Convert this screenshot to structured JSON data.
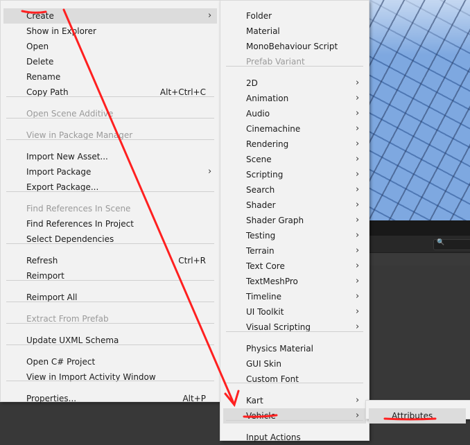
{
  "context_menu": {
    "items": [
      {
        "label": "Create",
        "shortcut": "",
        "submenu": true,
        "disabled": false
      },
      {
        "label": "Show in Explorer",
        "shortcut": "",
        "submenu": false,
        "disabled": false
      },
      {
        "label": "Open",
        "shortcut": "",
        "submenu": false,
        "disabled": false
      },
      {
        "label": "Delete",
        "shortcut": "",
        "submenu": false,
        "disabled": false
      },
      {
        "label": "Rename",
        "shortcut": "",
        "submenu": false,
        "disabled": false
      },
      {
        "label": "Copy Path",
        "shortcut": "Alt+Ctrl+C",
        "submenu": false,
        "disabled": false
      },
      {
        "label": "Open Scene Additive",
        "shortcut": "",
        "submenu": false,
        "disabled": true
      },
      {
        "label": "View in Package Manager",
        "shortcut": "",
        "submenu": false,
        "disabled": true
      },
      {
        "label": "Import New Asset...",
        "shortcut": "",
        "submenu": false,
        "disabled": false
      },
      {
        "label": "Import Package",
        "shortcut": "",
        "submenu": true,
        "disabled": false
      },
      {
        "label": "Export Package...",
        "shortcut": "",
        "submenu": false,
        "disabled": false
      },
      {
        "label": "Find References In Scene",
        "shortcut": "",
        "submenu": false,
        "disabled": true
      },
      {
        "label": "Find References In Project",
        "shortcut": "",
        "submenu": false,
        "disabled": false
      },
      {
        "label": "Select Dependencies",
        "shortcut": "",
        "submenu": false,
        "disabled": false
      },
      {
        "label": "Refresh",
        "shortcut": "Ctrl+R",
        "submenu": false,
        "disabled": false
      },
      {
        "label": "Reimport",
        "shortcut": "",
        "submenu": false,
        "disabled": false
      },
      {
        "label": "Reimport All",
        "shortcut": "",
        "submenu": false,
        "disabled": false
      },
      {
        "label": "Extract From Prefab",
        "shortcut": "",
        "submenu": false,
        "disabled": true
      },
      {
        "label": "Update UXML Schema",
        "shortcut": "",
        "submenu": false,
        "disabled": false
      },
      {
        "label": "Open C# Project",
        "shortcut": "",
        "submenu": false,
        "disabled": false
      },
      {
        "label": "View in Import Activity Window",
        "shortcut": "",
        "submenu": false,
        "disabled": false
      },
      {
        "label": "Properties...",
        "shortcut": "Alt+P",
        "submenu": false,
        "disabled": false
      }
    ]
  },
  "create_submenu": {
    "items": [
      {
        "label": "Folder",
        "submenu": false,
        "disabled": false
      },
      {
        "label": "Material",
        "submenu": false,
        "disabled": false
      },
      {
        "label": "MonoBehaviour Script",
        "submenu": false,
        "disabled": false
      },
      {
        "label": "Prefab Variant",
        "submenu": false,
        "disabled": true
      },
      {
        "label": "2D",
        "submenu": true,
        "disabled": false
      },
      {
        "label": "Animation",
        "submenu": true,
        "disabled": false
      },
      {
        "label": "Audio",
        "submenu": true,
        "disabled": false
      },
      {
        "label": "Cinemachine",
        "submenu": true,
        "disabled": false
      },
      {
        "label": "Rendering",
        "submenu": true,
        "disabled": false
      },
      {
        "label": "Scene",
        "submenu": true,
        "disabled": false
      },
      {
        "label": "Scripting",
        "submenu": true,
        "disabled": false
      },
      {
        "label": "Search",
        "submenu": true,
        "disabled": false
      },
      {
        "label": "Shader",
        "submenu": true,
        "disabled": false
      },
      {
        "label": "Shader Graph",
        "submenu": true,
        "disabled": false
      },
      {
        "label": "Testing",
        "submenu": true,
        "disabled": false
      },
      {
        "label": "Terrain",
        "submenu": true,
        "disabled": false
      },
      {
        "label": "Text Core",
        "submenu": true,
        "disabled": false
      },
      {
        "label": "TextMeshPro",
        "submenu": true,
        "disabled": false
      },
      {
        "label": "Timeline",
        "submenu": true,
        "disabled": false
      },
      {
        "label": "UI Toolkit",
        "submenu": true,
        "disabled": false
      },
      {
        "label": "Visual Scripting",
        "submenu": true,
        "disabled": false
      },
      {
        "label": "Physics Material",
        "submenu": false,
        "disabled": false
      },
      {
        "label": "GUI Skin",
        "submenu": false,
        "disabled": false
      },
      {
        "label": "Custom Font",
        "submenu": false,
        "disabled": false
      },
      {
        "label": "Kart",
        "submenu": true,
        "disabled": false
      },
      {
        "label": "Vehicle",
        "submenu": true,
        "disabled": false
      },
      {
        "label": "Input Actions",
        "submenu": false,
        "disabled": false
      }
    ]
  },
  "vehicle_submenu": {
    "items": [
      {
        "label": "Attributes",
        "submenu": false,
        "disabled": false
      }
    ]
  },
  "icons": {
    "submenu_arrow": "›",
    "search": "🔍"
  },
  "annotation_color": "#ff2020"
}
